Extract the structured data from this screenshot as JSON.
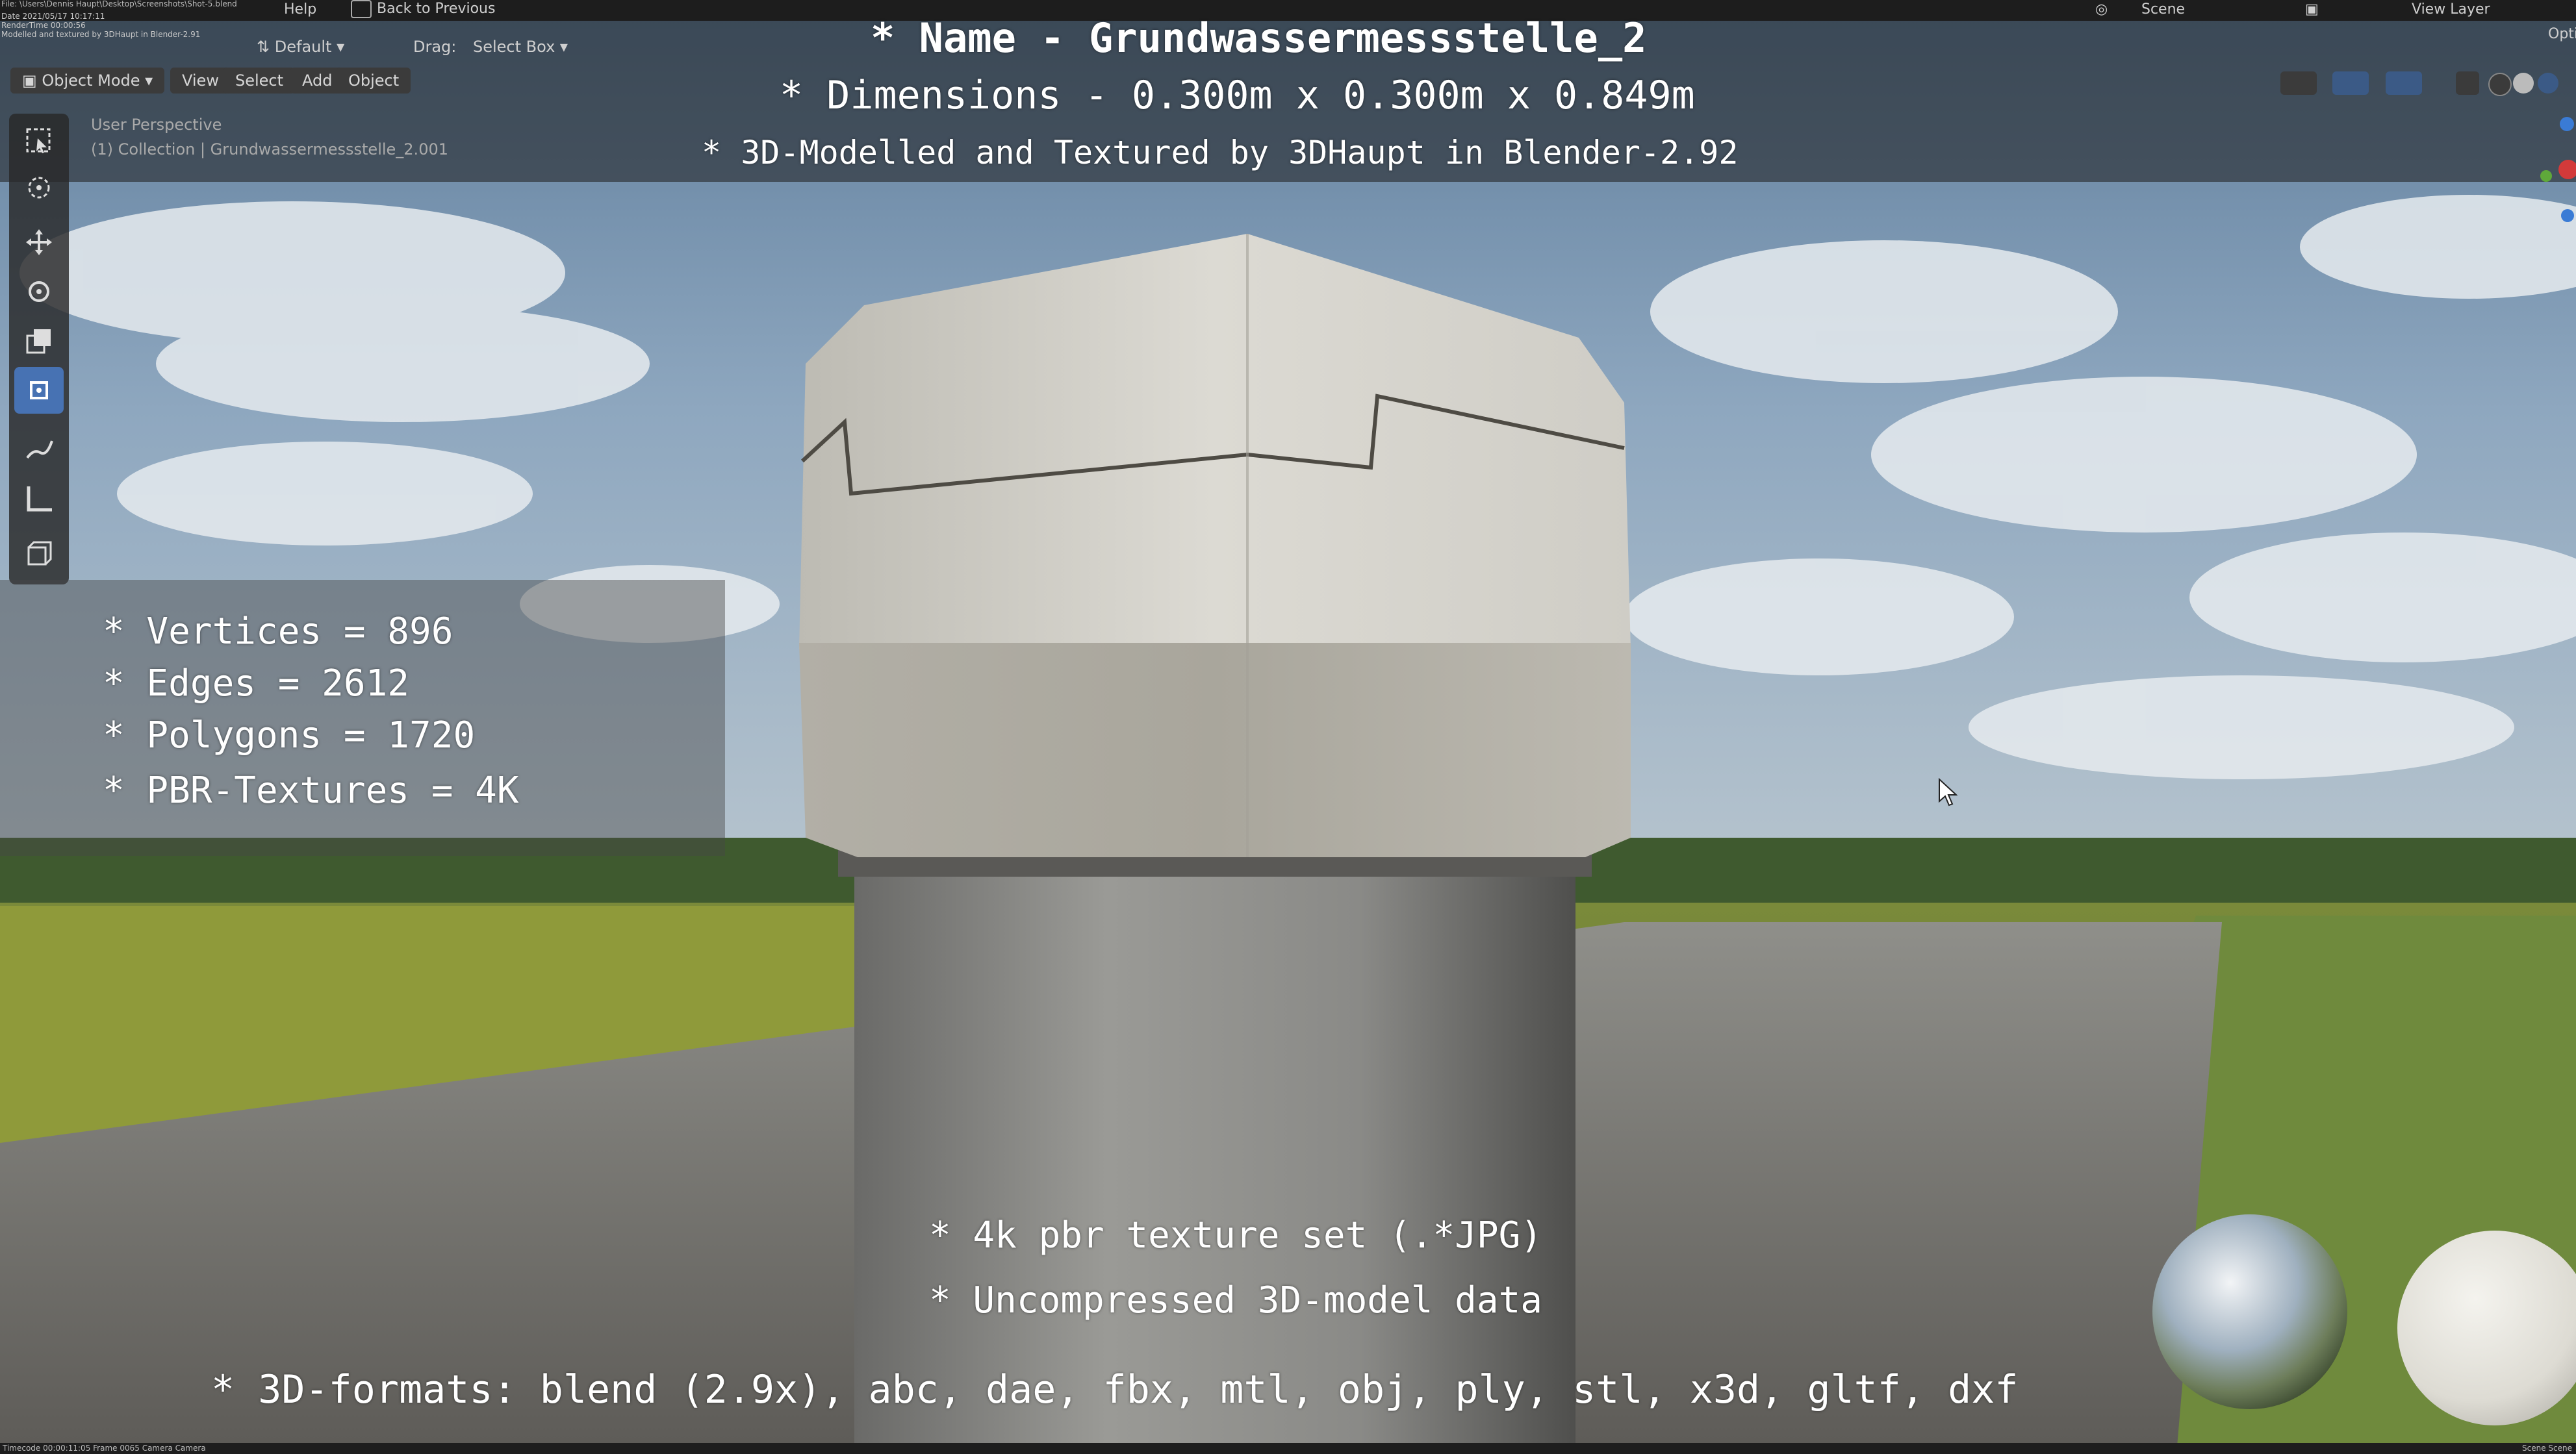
{
  "topbar": {
    "menu_help": "Help",
    "back_to_previous": "Back to Previous",
    "scene_label": "Scene",
    "view_layer_label": "View Layer",
    "options_label": "Opti",
    "file_info_line1": "File: \\Users\\Dennis Haupt\\Desktop\\Screenshots\\Shot-5.blend",
    "file_info_line2": "Date 2021/05/17 10:17:11",
    "file_info_line3": "RenderTime 00:00:56",
    "file_info_line4": "Modelled and textured by 3DHaupt in Blender-2.91"
  },
  "header": {
    "orientation": "Default",
    "drag_label": "Drag:",
    "drag_value": "Select Box",
    "mode": "Object Mode",
    "view": "View",
    "select": "Select",
    "add": "Add",
    "object": "Object"
  },
  "viewport": {
    "perspective_label": "User Perspective",
    "collection_label": "(1) Collection | Grundwassermessstelle_2.001"
  },
  "overlay": {
    "name_line": "* Name - Grundwassermessstelle_2",
    "dimensions_line": "* Dimensions -  0.300m x 0.300m x 0.849m",
    "credit_line": "* 3D-Modelled and Textured by 3DHaupt in Blender-2.92",
    "stats": {
      "vertices": "* Vertices = 896",
      "edges": "* Edges = 2612",
      "polygons": "* Polygons = 1720",
      "textures": "* PBR-Textures = 4K"
    },
    "texture_set": "* 4k pbr texture set (.*JPG)",
    "model_data": "* Uncompressed 3D-model data",
    "formats": "* 3D-formats: blend (2.9x), abc, dae, fbx, mtl, obj, ply, stl, x3d, gltf, dxf"
  },
  "footer": {
    "timecode": "Timecode 00:00:11:05   Frame 0065   Camera Camera",
    "right": "Scene Scene"
  },
  "icons": [
    "select-box-icon",
    "cursor-icon",
    "move-icon",
    "rotate-icon",
    "scale-icon",
    "transform-icon",
    "annotate-icon",
    "measure-icon",
    "add-cube-icon"
  ]
}
